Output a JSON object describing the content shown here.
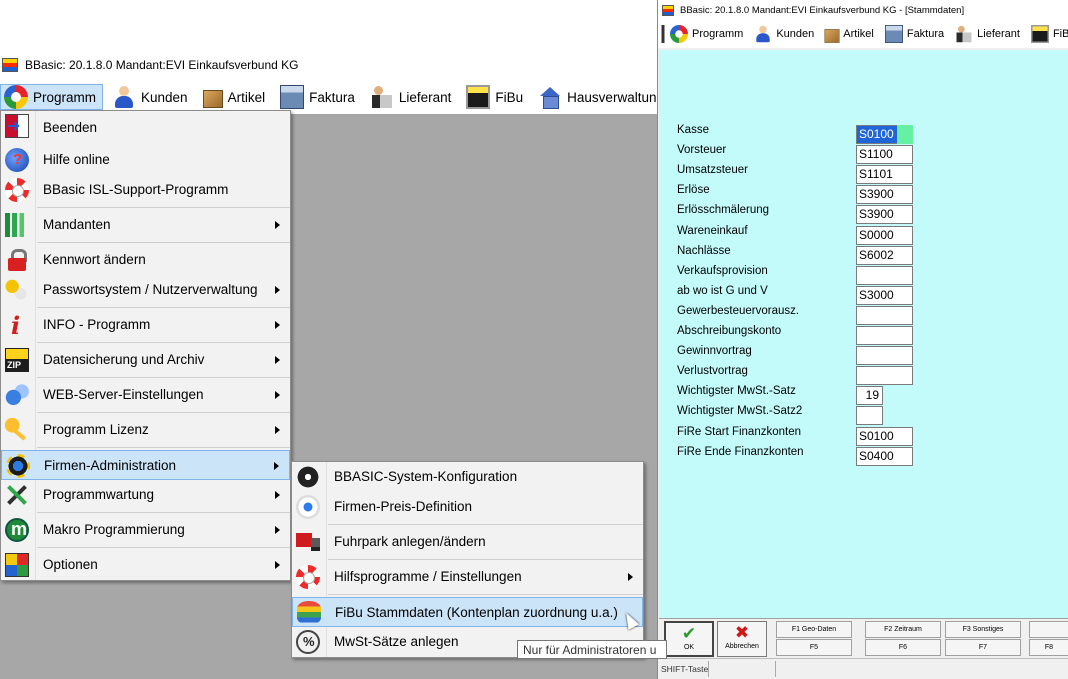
{
  "main_window": {
    "title": "BBasic: 20.1.8.0 Mandant:EVI Einkaufsverbund KG",
    "menubar": [
      {
        "label": "Programm",
        "icon": "programm-icon"
      },
      {
        "label": "Kunden",
        "icon": "kunden-icon"
      },
      {
        "label": "Artikel",
        "icon": "artikel-icon"
      },
      {
        "label": "Faktura",
        "icon": "faktura-icon"
      },
      {
        "label": "Lieferant",
        "icon": "lieferant-icon"
      },
      {
        "label": "FiBu",
        "icon": "fibu-icon"
      },
      {
        "label": "Hausverwaltung",
        "icon": "hausverwaltung-icon"
      }
    ]
  },
  "programm_menu": [
    {
      "label": "Beenden",
      "icon": "exit-icon",
      "submenu": false
    },
    {
      "label": "Hilfe online",
      "icon": "help-globe-icon",
      "submenu": false
    },
    {
      "label": "BBasic ISL-Support-Programm",
      "icon": "lifebuoy-icon",
      "submenu": false
    },
    {
      "label": "Mandanten",
      "icon": "mandanten-icon",
      "submenu": true
    },
    {
      "label": "Kennwort ändern",
      "icon": "lock-icon",
      "submenu": false
    },
    {
      "label": "Passwortsystem / Nutzerverwaltung",
      "icon": "keys-icon",
      "submenu": true
    },
    {
      "label": "INFO - Programm",
      "icon": "info-icon",
      "submenu": true
    },
    {
      "label": "Datensicherung und Archiv",
      "icon": "zip-icon",
      "submenu": true
    },
    {
      "label": "WEB-Server-Einstellungen",
      "icon": "web-server-icon",
      "submenu": true
    },
    {
      "label": "Programm Lizenz",
      "icon": "key-icon",
      "submenu": true
    },
    {
      "label": "Firmen-Administration",
      "icon": "cog-icon",
      "submenu": true
    },
    {
      "label": "Programmwartung",
      "icon": "tools-icon",
      "submenu": true
    },
    {
      "label": "Makro Programmierung",
      "icon": "makro-icon",
      "submenu": true
    },
    {
      "label": "Optionen",
      "icon": "options-icon",
      "submenu": true
    }
  ],
  "firmen_submenu": [
    {
      "label": "BBASIC-System-Konfiguration",
      "icon": "gear-icon",
      "submenu": false
    },
    {
      "label": "Firmen-Preis-Definition",
      "icon": "target-dot-icon",
      "submenu": false
    },
    {
      "label": "Fuhrpark anlegen/ändern",
      "icon": "truck-icon",
      "submenu": false
    },
    {
      "label": "Hilfsprogramme / Einstellungen",
      "icon": "lifebuoy-icon",
      "submenu": true
    },
    {
      "label": "FiBu Stammdaten (Kontenplan zuordnung u.a.)",
      "icon": "coins-icon",
      "submenu": false
    },
    {
      "label": "MwSt-Sätze anlegen",
      "icon": "percent-icon",
      "submenu": false
    }
  ],
  "tooltip": "Nur für Administratoren u",
  "stammdaten_window": {
    "title": "BBasic: 20.1.8.0 Mandant:EVI Einkaufsverbund KG - [Stammdaten]",
    "menubar": [
      {
        "label": "Programm",
        "icon": "programm-icon"
      },
      {
        "label": "Kunden",
        "icon": "kunden-icon"
      },
      {
        "label": "Artikel",
        "icon": "artikel-icon"
      },
      {
        "label": "Faktura",
        "icon": "faktura-icon"
      },
      {
        "label": "Lieferant",
        "icon": "lieferant-icon"
      },
      {
        "label": "FiBu",
        "icon": "fibu-icon"
      }
    ],
    "fields": [
      {
        "label": "Kasse",
        "value": "S0100"
      },
      {
        "label": "Vorsteuer",
        "value": "S1100"
      },
      {
        "label": "Umsatzsteuer",
        "value": "S1101"
      },
      {
        "label": "Erlöse",
        "value": "S3900"
      },
      {
        "label": "Erlösschmälerung",
        "value": "S3900"
      },
      {
        "label": "Wareneinkauf",
        "value": "S0000"
      },
      {
        "label": "Nachlässe",
        "value": "S6002"
      },
      {
        "label": "Verkaufsprovision",
        "value": ""
      },
      {
        "label": "ab wo ist G und V",
        "value": "S3000"
      },
      {
        "label": "Gewerbesteuervorausz.",
        "value": ""
      },
      {
        "label": "Abschreibungskonto",
        "value": ""
      },
      {
        "label": "Gewinnvortrag",
        "value": ""
      },
      {
        "label": "Verlustvortrag",
        "value": ""
      },
      {
        "label": "Wichtigster MwSt.-Satz",
        "value": "19"
      },
      {
        "label": "Wichtigster MwSt.-Satz2",
        "value": ""
      },
      {
        "label": "FiRe Start Finanzkonten",
        "value": "S0100"
      },
      {
        "label": "FiRe Ende Finanzkonten",
        "value": "S0400"
      }
    ],
    "buttons": {
      "ok": "OK",
      "cancel": "Abbrechen",
      "f1": "F1 Geo-Daten",
      "f2": "F2 Zeitraum",
      "f3": "F3 Sonstiges",
      "f5": "F5",
      "f6": "F6",
      "f7": "F7",
      "f8": "F8"
    },
    "status": "SHIFT-Taste"
  }
}
